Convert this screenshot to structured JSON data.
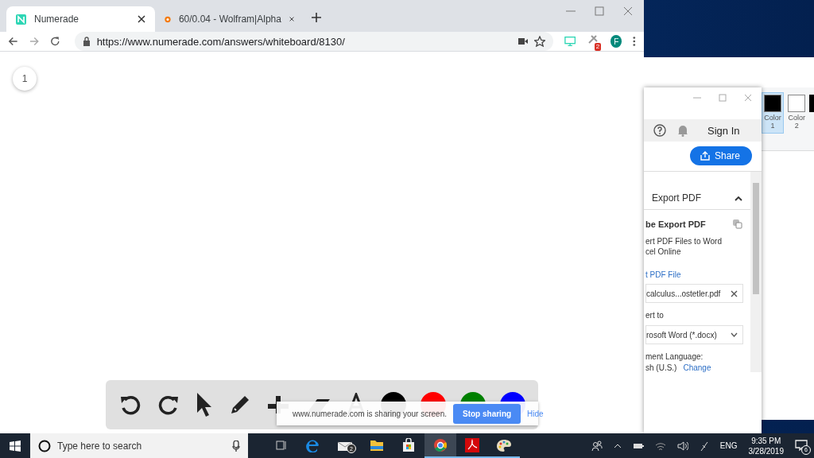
{
  "browser": {
    "tabs": [
      {
        "title": "Numerade",
        "selected": true
      },
      {
        "title": "60/0.04 - Wolfram|Alpha",
        "selected": false
      }
    ],
    "url": "https://www.numerade.com/answers/whiteboard/8130/",
    "extension_badge": "2",
    "profile_initial": "F"
  },
  "whiteboard": {
    "page_number": "1",
    "tools": [
      {
        "kind": "undo"
      },
      {
        "kind": "redo"
      },
      {
        "kind": "select"
      },
      {
        "kind": "pencil"
      },
      {
        "kind": "plus"
      },
      {
        "kind": "eraser"
      },
      {
        "kind": "text"
      }
    ],
    "colors": [
      {
        "color": "#000000"
      },
      {
        "color": "#ff0000"
      },
      {
        "color": "#008000"
      },
      {
        "color": "#0000ff"
      }
    ]
  },
  "share_banner": {
    "message": "www.numerade.com is sharing your screen.",
    "stop_button": "Stop sharing",
    "hide_link": "Hide"
  },
  "acrobat_panel": {
    "sign_in": "Sign In",
    "share_button": "Share",
    "section": {
      "title": "Export PDF",
      "expanded": true
    },
    "heading": "be Export PDF",
    "description": [
      "ert PDF Files to Word",
      "cel Online"
    ],
    "select_link": "t PDF File",
    "file": "calculus...ostetler.pdf",
    "convert_label": "ert to",
    "format": "rosoft Word (*.docx)",
    "language_label": "ment Language:",
    "language": "sh (U.S.)",
    "change_link": "Change"
  },
  "paint": {
    "colors": [
      {
        "label": "Color 1",
        "color": "#000000",
        "selected": true
      },
      {
        "label": "Color 2",
        "color": "#ffffff",
        "selected": false
      }
    ]
  },
  "taskbar": {
    "search_placeholder": "Type here to search",
    "apps": [
      {
        "kind": "task-view",
        "running": false,
        "active": false
      },
      {
        "kind": "edge",
        "running": false,
        "active": false
      },
      {
        "kind": "mail",
        "running": false,
        "active": false,
        "badge": "2"
      },
      {
        "kind": "folder",
        "running": false,
        "active": false
      },
      {
        "kind": "store",
        "running": false,
        "active": false
      },
      {
        "kind": "chrome",
        "running": true,
        "active": true
      },
      {
        "kind": "pdf",
        "running": true,
        "active": false
      },
      {
        "kind": "paint",
        "running": true,
        "active": false
      }
    ],
    "language": "ENG",
    "time": "9:35 PM",
    "date": "3/28/2019",
    "notifications": "6"
  }
}
